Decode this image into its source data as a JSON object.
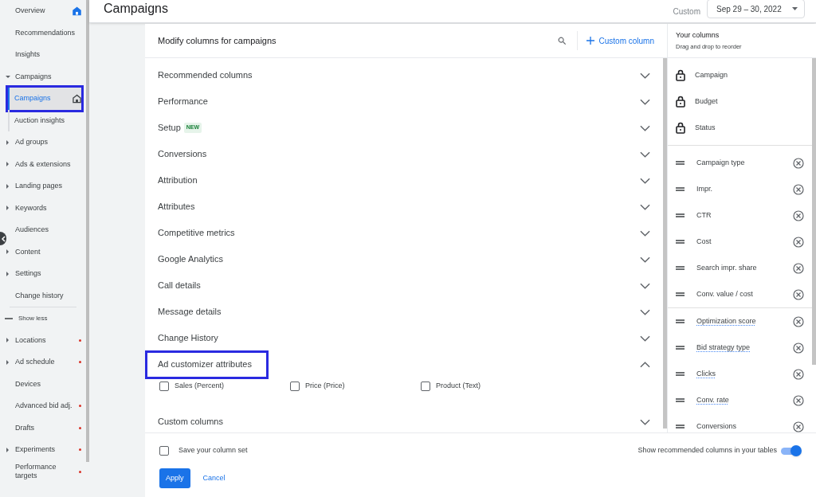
{
  "sidebar": {
    "items": [
      {
        "label": "Overview",
        "kind": "pinned",
        "alert": false,
        "selected": false,
        "highlighted": false
      },
      {
        "label": "Recommendations",
        "kind": "link",
        "alert": false,
        "selected": false,
        "highlighted": false
      },
      {
        "label": "Insights",
        "kind": "link",
        "alert": false,
        "selected": false,
        "highlighted": false
      },
      {
        "label": "Campaigns",
        "kind": "group",
        "expanded": true,
        "alert": false,
        "selected": false,
        "highlighted": false,
        "children": [
          {
            "label": "Campaigns",
            "kind": "pinned",
            "alert": false,
            "selected": true,
            "highlighted": true
          },
          {
            "label": "Auction insights",
            "kind": "link",
            "alert": false,
            "selected": false,
            "highlighted": false
          }
        ]
      },
      {
        "label": "Ad groups",
        "kind": "group",
        "expanded": false,
        "alert": false,
        "selected": false,
        "highlighted": false
      },
      {
        "label": "Ads & extensions",
        "kind": "group",
        "expanded": false,
        "alert": false,
        "selected": false,
        "highlighted": false
      },
      {
        "label": "Landing pages",
        "kind": "group",
        "expanded": false,
        "alert": false,
        "selected": false,
        "highlighted": false
      },
      {
        "label": "Keywords",
        "kind": "group",
        "expanded": false,
        "alert": false,
        "selected": false,
        "highlighted": false
      },
      {
        "label": "Audiences",
        "kind": "link",
        "alert": false,
        "selected": false,
        "highlighted": false
      },
      {
        "label": "Content",
        "kind": "group",
        "expanded": false,
        "alert": false,
        "selected": false,
        "highlighted": false
      },
      {
        "label": "Settings",
        "kind": "group",
        "expanded": false,
        "alert": false,
        "selected": false,
        "highlighted": false
      },
      {
        "label": "Change history",
        "kind": "link",
        "alert": false,
        "selected": false,
        "highlighted": false
      }
    ],
    "show_less": "Show less",
    "more_items": [
      {
        "label": "Locations",
        "kind": "group",
        "expanded": false,
        "alert": true,
        "selected": false,
        "highlighted": false
      },
      {
        "label": "Ad schedule",
        "kind": "group",
        "expanded": false,
        "alert": true,
        "selected": false,
        "highlighted": false
      },
      {
        "label": "Devices",
        "kind": "link",
        "alert": false,
        "selected": false,
        "highlighted": false
      },
      {
        "label": "Advanced bid adj.",
        "kind": "link",
        "alert": true,
        "selected": false,
        "highlighted": false
      },
      {
        "label": "Drafts",
        "kind": "link",
        "alert": true,
        "selected": false,
        "highlighted": false
      },
      {
        "label": "Experiments",
        "kind": "group",
        "expanded": false,
        "alert": true,
        "selected": false,
        "highlighted": false
      },
      {
        "label": "Performance targets",
        "kind": "link",
        "alert": true,
        "selected": false,
        "highlighted": false
      }
    ]
  },
  "header": {
    "title": "Campaigns",
    "range_label": "Custom",
    "date_range": "Sep 29 – 30, 2022"
  },
  "dialog": {
    "title": "Modify columns for campaigns",
    "custom_column": "Custom column",
    "categories": [
      {
        "label": "Recommended columns",
        "expanded": false,
        "highlighted": false
      },
      {
        "label": "Performance",
        "expanded": false,
        "highlighted": false
      },
      {
        "label": "Setup",
        "badge": "NEW",
        "expanded": false,
        "highlighted": false
      },
      {
        "label": "Conversions",
        "expanded": false,
        "highlighted": false
      },
      {
        "label": "Attribution",
        "expanded": false,
        "highlighted": false
      },
      {
        "label": "Attributes",
        "expanded": false,
        "highlighted": false
      },
      {
        "label": "Competitive metrics",
        "expanded": false,
        "highlighted": false
      },
      {
        "label": "Google Analytics",
        "expanded": false,
        "highlighted": false
      },
      {
        "label": "Call details",
        "expanded": false,
        "highlighted": false
      },
      {
        "label": "Message details",
        "expanded": false,
        "highlighted": false
      },
      {
        "label": "Change History",
        "expanded": false,
        "highlighted": false
      },
      {
        "label": "Ad customizer attributes",
        "expanded": true,
        "highlighted": true,
        "options": [
          {
            "label": "Sales (Percent)",
            "checked": false
          },
          {
            "label": "Price (Price)",
            "checked": false
          },
          {
            "label": "Product (Text)",
            "checked": false
          }
        ]
      },
      {
        "label": "Custom columns",
        "expanded": false,
        "highlighted": false
      }
    ],
    "save_set": {
      "label": "Save your column set",
      "checked": false
    },
    "show_recommended": {
      "label": "Show recommended columns in your tables",
      "on": true
    },
    "buttons": [
      "Apply",
      "Cancel"
    ]
  },
  "your_columns": {
    "title": "Your columns",
    "subtitle": "Drag and drop to reorder",
    "groups": [
      [
        {
          "label": "Campaign",
          "kind": "locked",
          "underlined": false
        },
        {
          "label": "Budget",
          "kind": "locked",
          "underlined": false
        },
        {
          "label": "Status",
          "kind": "locked",
          "underlined": false
        }
      ],
      [
        {
          "label": "Campaign type",
          "kind": "movable",
          "underlined": false
        },
        {
          "label": "Impr.",
          "kind": "movable",
          "underlined": false
        },
        {
          "label": "CTR",
          "kind": "movable",
          "underlined": false
        },
        {
          "label": "Cost",
          "kind": "movable",
          "underlined": false
        },
        {
          "label": "Search impr. share",
          "kind": "movable",
          "underlined": false
        },
        {
          "label": "Conv. value / cost",
          "kind": "movable",
          "underlined": false
        }
      ],
      [
        {
          "label": "Optimization score",
          "kind": "movable",
          "underlined": true
        },
        {
          "label": "Bid strategy type",
          "kind": "movable",
          "underlined": true
        },
        {
          "label": "Clicks",
          "kind": "movable",
          "underlined": true
        },
        {
          "label": "Conv. rate",
          "kind": "movable",
          "underlined": true
        },
        {
          "label": "Conversions",
          "kind": "movable",
          "underlined": false
        }
      ]
    ]
  }
}
